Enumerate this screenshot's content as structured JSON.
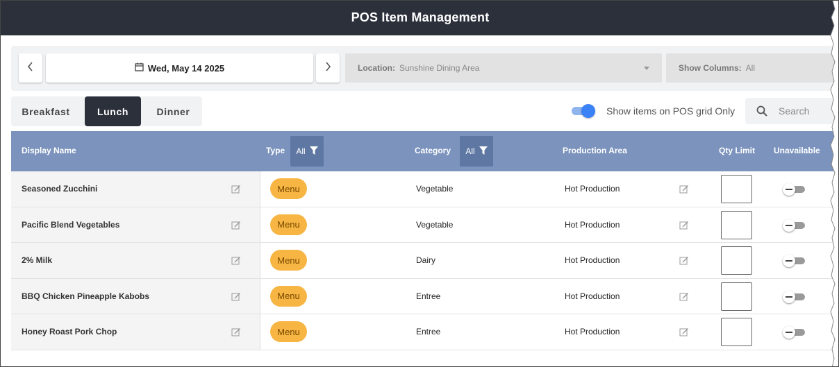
{
  "window": {
    "title": "POS Item Management"
  },
  "date_nav": {
    "prev_icon": "chevron-left-icon",
    "next_icon": "chevron-right-icon",
    "calendar_icon": "calendar-icon",
    "date_label": "Wed, May 14 2025"
  },
  "location": {
    "label": "Location:",
    "value": "Sunshine Dining Area"
  },
  "show_columns": {
    "label": "Show Columns:",
    "value": "All"
  },
  "meal_tabs": [
    {
      "label": "Breakfast",
      "active": false
    },
    {
      "label": "Lunch",
      "active": true
    },
    {
      "label": "Dinner",
      "active": false
    }
  ],
  "pos_grid_toggle": {
    "label": "Show items on POS grid Only",
    "on": true
  },
  "search": {
    "placeholder": "Search",
    "icon": "search-icon"
  },
  "table": {
    "headers": {
      "display_name": "Display Name",
      "type": "Type",
      "type_filter": "All",
      "category": "Category",
      "category_filter": "All",
      "production_area": "Production Area",
      "qty_limit": "Qty Limit",
      "unavailable": "Unavailable"
    },
    "rows": [
      {
        "name": "Seasoned Zucchini",
        "type": "Menu",
        "category": "Vegetable",
        "production": "Hot Production",
        "qty": "",
        "unavailable": false
      },
      {
        "name": "Pacific Blend Vegetables",
        "type": "Menu",
        "category": "Vegetable",
        "production": "Hot Production",
        "qty": "",
        "unavailable": false
      },
      {
        "name": "2% Milk",
        "type": "Menu",
        "category": "Dairy",
        "production": "Hot Production",
        "qty": "",
        "unavailable": false
      },
      {
        "name": "BBQ Chicken Pineapple Kabobs",
        "type": "Menu",
        "category": "Entree",
        "production": "Hot Production",
        "qty": "",
        "unavailable": false
      },
      {
        "name": "Honey Roast Pork Chop",
        "type": "Menu",
        "category": "Entree",
        "production": "Hot Production",
        "qty": "",
        "unavailable": false
      }
    ]
  },
  "colors": {
    "titlebar": "#2b303b",
    "table_header": "#7b93bd",
    "filter_chip": "#5e78a3",
    "type_pill": "#f7b543",
    "toggle_on": "#3b82f6"
  }
}
